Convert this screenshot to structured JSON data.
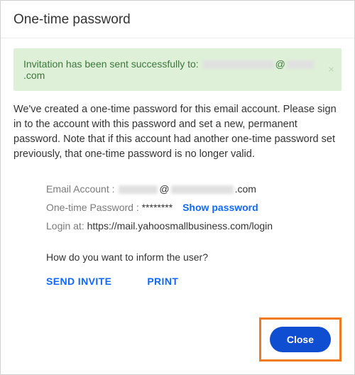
{
  "header": {
    "title": "One-time password"
  },
  "alert": {
    "prefix": "Invitation has been sent successfully to: ",
    "at": "@",
    "domain_suffix": ".com"
  },
  "body": {
    "text": "We've created a one-time password for this email account. Please sign in to the account with this password and set a new, permanent password. Note that if this account had   another one-time password set previously, that one-time password is no longer valid."
  },
  "details": {
    "email_label": "Email Account : ",
    "email_at": "@",
    "email_suffix": ".com",
    "otp_label": "One-time Password : ",
    "otp_masked": "********",
    "show_password": "Show password",
    "login_label": "Login at: ",
    "login_url": "https://mail.yahoosmallbusiness.com/login"
  },
  "inform": {
    "question": "How do you want to inform the user?",
    "send_invite": "SEND INVITE",
    "print": "PRINT"
  },
  "footer": {
    "close": "Close"
  }
}
